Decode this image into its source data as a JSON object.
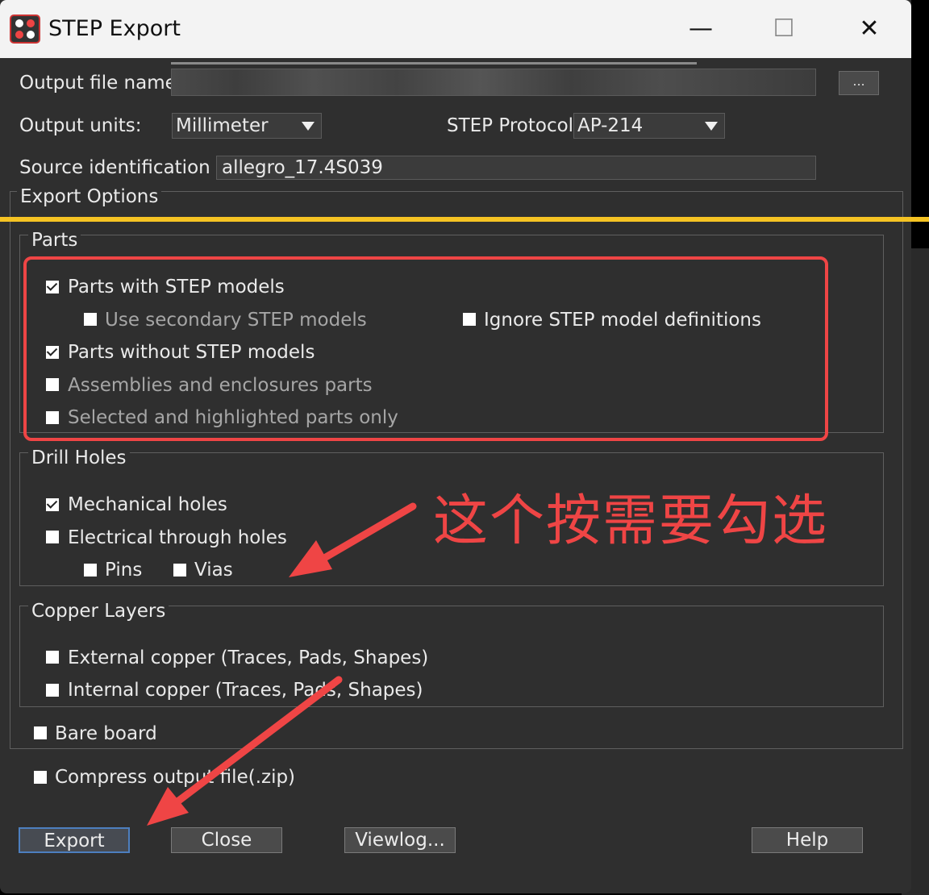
{
  "window": {
    "title": "STEP Export",
    "controls": {
      "minimize": "—",
      "maximize": "☐",
      "close": "✕"
    }
  },
  "form": {
    "output_file_label": "Output file name:",
    "browse_label": "...",
    "output_units_label": "Output units:",
    "output_units_value": "Millimeter",
    "step_protocol_label": "STEP Protocol:",
    "step_protocol_value": "AP-214",
    "source_id_label": "Source identification :",
    "source_id_value": "allegro_17.4S039"
  },
  "export_options": {
    "title": "Export Options",
    "parts": {
      "title": "Parts",
      "items": [
        {
          "label": "Parts with STEP models",
          "checked": true,
          "enabled": true
        },
        {
          "label": "Use secondary STEP models",
          "checked": false,
          "enabled": false
        },
        {
          "label": "Ignore STEP model definitions",
          "checked": false,
          "enabled": true
        },
        {
          "label": "Parts without STEP models",
          "checked": true,
          "enabled": true
        },
        {
          "label": "Assemblies and enclosures parts",
          "checked": false,
          "enabled": false
        },
        {
          "label": "Selected and highlighted parts only",
          "checked": false,
          "enabled": false
        }
      ]
    },
    "drill_holes": {
      "title": "Drill Holes",
      "items": [
        {
          "label": "Mechanical holes",
          "checked": true
        },
        {
          "label": "Electrical through holes",
          "checked": false
        },
        {
          "label": "Pins",
          "checked": false
        },
        {
          "label": "Vias",
          "checked": false
        }
      ]
    },
    "copper_layers": {
      "title": "Copper Layers",
      "items": [
        {
          "label": "External copper (Traces, Pads, Shapes)",
          "checked": false
        },
        {
          "label": "Internal copper (Traces, Pads, Shapes)",
          "checked": false
        }
      ]
    },
    "bare_board": {
      "label": "Bare board",
      "checked": false
    }
  },
  "compress": {
    "label": "Compress output file(.zip)",
    "checked": false
  },
  "buttons": {
    "export": "Export",
    "close": "Close",
    "viewlog": "Viewlog...",
    "help": "Help"
  },
  "annotation": {
    "text": "这个按需要勾选",
    "color": "#ef4545",
    "highlight_color": "#f5c323"
  }
}
